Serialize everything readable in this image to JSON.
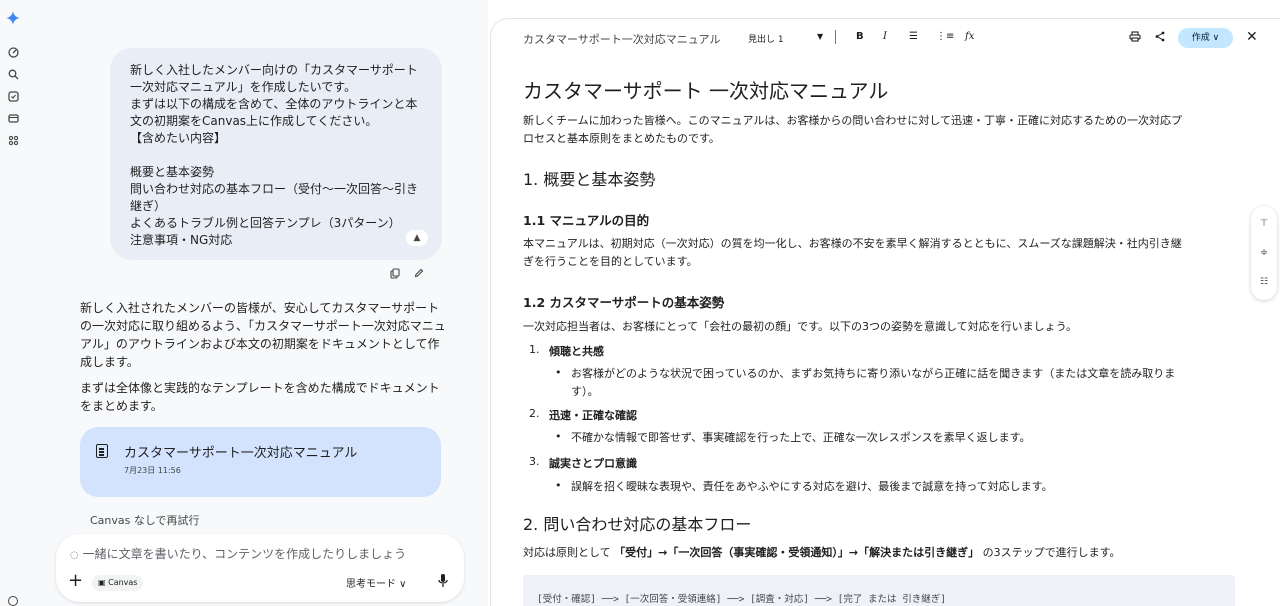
{
  "chat": {
    "user_message_lines": [
      "新しく入社したメンバー向けの「カスタマーサポート",
      "一次対応マニュアル」を作成したいです。",
      "まずは以下の構成を含めて、全体のアウトラインと本",
      "文の初期案をCanvas上に作成してください。",
      "【含めたい内容】",
      "",
      "概要と基本姿勢",
      "問い合わせ対応の基本フロー（受付〜一次回答〜引き",
      "継ぎ）",
      "よくあるトラブル例と回答テンプレ（3パターン）",
      "注意事項・NG対応"
    ],
    "reply_p1_lines": [
      "新しく入社されたメンバーの皆様が、安心してカスタマーサポート",
      "の一次対応に取り組めるよう、「カスタマーサポート一次対応マニュ",
      "アル」のアウトラインおよび本文の初期案をドキュメントとして作",
      "成します。"
    ],
    "reply_p2_lines": [
      "まずは全体像と実践的なテンプレートを含めた構成でドキュメント",
      "をまとめます。"
    ],
    "doc_card": {
      "title": "カスタマーサポート一次対応マニュアル",
      "date": "7月23日 11:56"
    },
    "retry_label": "Canvas なしで再試行",
    "composer": {
      "placeholder": "一緒に文章を書いたり、コンテンツを作成したりしましょう",
      "chip": "Canvas",
      "mode": "思考モード ∨"
    }
  },
  "canvas": {
    "toolbar": {
      "title": "カスタマーサポート一次対応マニュアル",
      "heading_select": "見出し 1",
      "bold": "B",
      "italic": "I",
      "create_button": "作成 ∨"
    },
    "doc": {
      "h1": "カスタマーサポート 一次対応マニュアル",
      "intro_lines": [
        "新しくチームに加わった皆様へ。このマニュアルは、お客様からの問い合わせに対して迅速・丁寧・正確に対応するための一次対応プ",
        "ロセスと基本原則をまとめたものです。"
      ],
      "s1": "1. 概要と基本姿勢",
      "s1_1": "1.1 マニュアルの目的",
      "s1_1_lines": [
        "本マニュアルは、初期対応（一次対応）の質を均一化し、お客様の不安を素早く解消するとともに、スムーズな課題解決・社内引き継",
        "ぎを行うことを目的としています。"
      ],
      "s1_2": "1.2 カスタマーサポートの基本姿勢",
      "s1_2_text": "一次対応担当者は、お客様にとって「会社の最初の顔」です。以下の3つの姿勢を意識して対応を行いましょう。",
      "stances": [
        {
          "num": "1.",
          "title": "傾聴と共感",
          "bullet_lines": [
            "お客様がどのような状況で困っているのか、まずお気持ちに寄り添いながら正確に話を聞きます（または文章を読み取りま",
            "す）。"
          ]
        },
        {
          "num": "2.",
          "title": "迅速・正確な確認",
          "bullet_lines": [
            "不確かな情報で即答せず、事実確認を行った上で、正確な一次レスポンスを素早く返します。"
          ]
        },
        {
          "num": "3.",
          "title": "誠実さとプロ意識",
          "bullet_lines": [
            "誤解を招く曖昧な表現や、責任をあやふやにする対応を避け、最後まで誠意を持って対応します。"
          ]
        }
      ],
      "s2": "2. 問い合わせ対応の基本フロー",
      "s2_pre": "対応は原則として",
      "s2_bold": "「受付」→「一次回答（事実確認・受領通知）」→「解決または引き継ぎ」",
      "s2_post": "の3ステップで進行します。",
      "flow": "[受付・確認] ──> [一次回答・受領連絡] ──> [調査・対応] ──> [完了 または 引き継ぎ]"
    }
  },
  "colors": {
    "chat_bg": "#f8f9fb",
    "bubble": "#e9eef6",
    "card": "#d3e3fd",
    "create_btn": "#c2e7ff"
  }
}
